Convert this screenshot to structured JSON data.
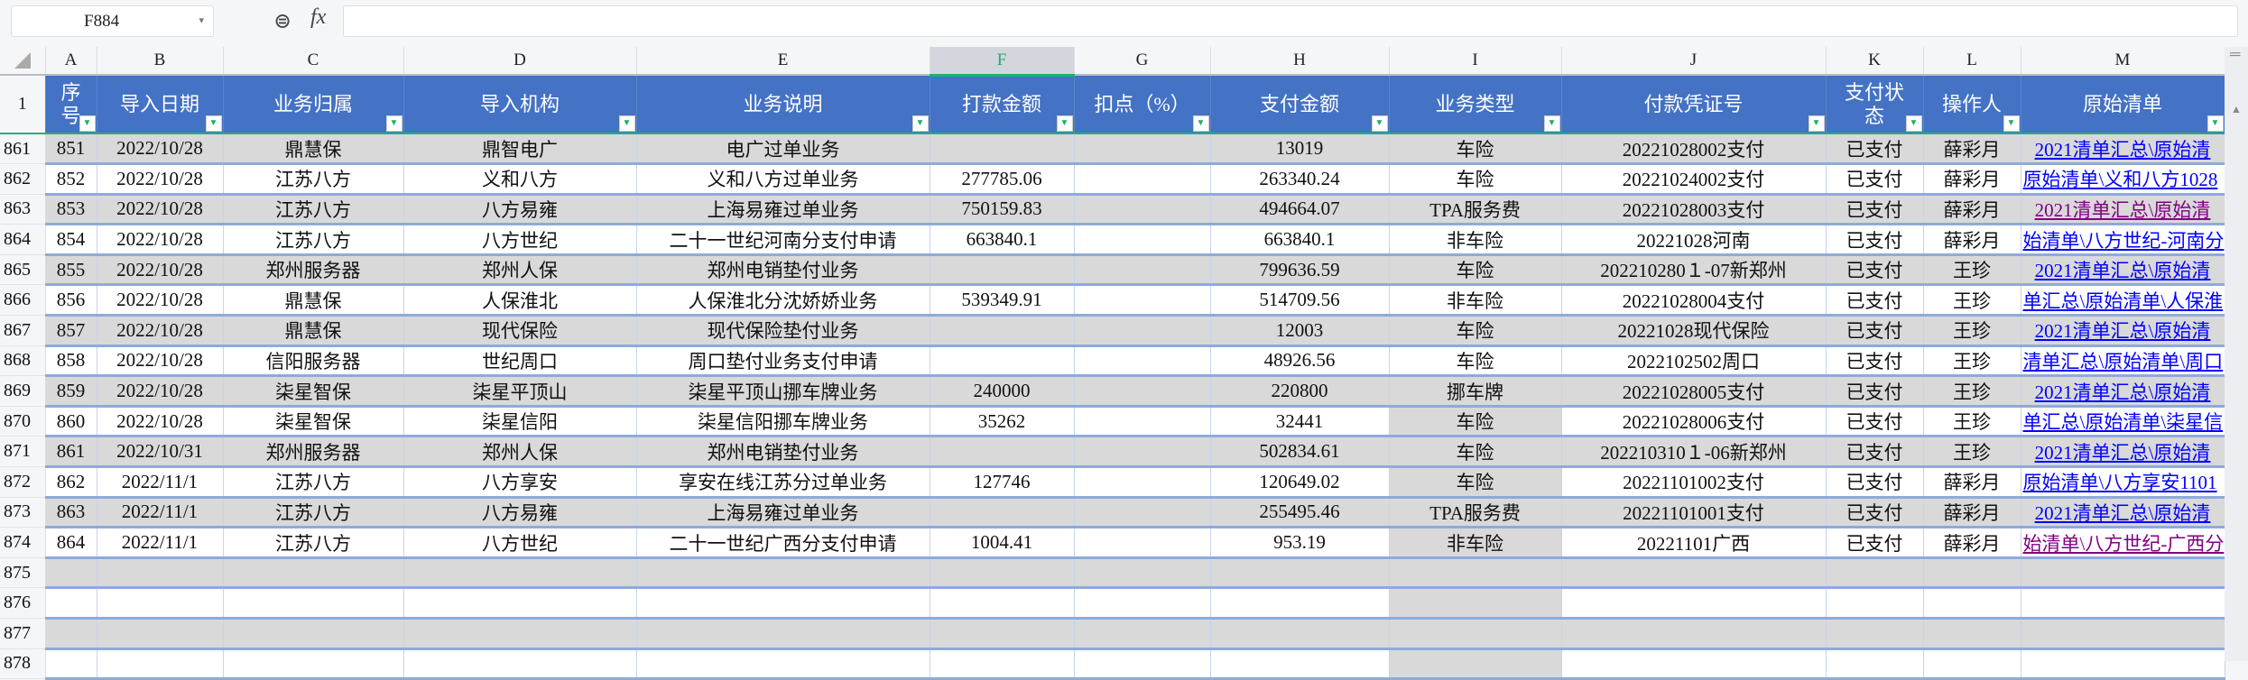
{
  "formula_bar": {
    "cell_ref": "F884",
    "fx_label": "fx",
    "formula": ""
  },
  "column_letters": [
    "A",
    "B",
    "C",
    "D",
    "E",
    "F",
    "G",
    "H",
    "I",
    "J",
    "K",
    "L",
    "M"
  ],
  "selected_column": "F",
  "header_row_number": "1",
  "headers": [
    "序号",
    "导入日期",
    "业务归属",
    "导入机构",
    "业务说明",
    "打款金额",
    "扣点（%）",
    "支付金额",
    "业务类型",
    "付款凭证号",
    "支付状态",
    "操作人",
    "原始清单"
  ],
  "rows": [
    {
      "n": "861",
      "cells": [
        "851",
        "2022/10/28",
        "鼎慧保",
        "鼎智电广",
        "电广过单业务",
        "",
        "",
        "13019",
        "车险",
        "20221028002支付",
        "已支付",
        "薛彩月",
        "2021清单汇总\\原始清"
      ],
      "visited": false
    },
    {
      "n": "862",
      "cells": [
        "852",
        "2022/10/28",
        "江苏八方",
        "义和八方",
        "义和八方过单业务",
        "277785.06",
        "",
        "263340.24",
        "车险",
        "20221024002支付",
        "已支付",
        "薛彩月",
        "原始清单\\义和八方1028"
      ],
      "visited": false
    },
    {
      "n": "863",
      "cells": [
        "853",
        "2022/10/28",
        "江苏八方",
        "八方易雍",
        "上海易雍过单业务",
        "750159.83",
        "",
        "494664.07",
        "TPA服务费",
        "20221028003支付",
        "已支付",
        "薛彩月",
        "2021清单汇总\\原始清"
      ],
      "visited": true
    },
    {
      "n": "864",
      "cells": [
        "854",
        "2022/10/28",
        "江苏八方",
        "八方世纪",
        "二十一世纪河南分支付申请",
        "663840.1",
        "",
        "663840.1",
        "非车险",
        "20221028河南",
        "已支付",
        "薛彩月",
        "始清单\\八方世纪-河南分"
      ],
      "visited": false
    },
    {
      "n": "865",
      "cells": [
        "855",
        "2022/10/28",
        "郑州服务器",
        "郑州人保",
        "郑州电销垫付业务",
        "",
        "",
        "799636.59",
        "车险",
        "202210280１-07新郑州",
        "已支付",
        "王珍",
        "2021清单汇总\\原始清"
      ],
      "visited": false
    },
    {
      "n": "866",
      "cells": [
        "856",
        "2022/10/28",
        "鼎慧保",
        "人保淮北",
        "人保淮北分沈娇娇业务",
        "539349.91",
        "",
        "514709.56",
        "非车险",
        "20221028004支付",
        "已支付",
        "王珍",
        "单汇总\\原始清单\\人保淮"
      ],
      "visited": false
    },
    {
      "n": "867",
      "cells": [
        "857",
        "2022/10/28",
        "鼎慧保",
        "现代保险",
        "现代保险垫付业务",
        "",
        "",
        "12003",
        "车险",
        "20221028现代保险",
        "已支付",
        "王珍",
        "2021清单汇总\\原始清"
      ],
      "visited": false
    },
    {
      "n": "868",
      "cells": [
        "858",
        "2022/10/28",
        "信阳服务器",
        "世纪周口",
        "周口垫付业务支付申请",
        "",
        "",
        "48926.56",
        "车险",
        "2022102502周口",
        "已支付",
        "王珍",
        "清单汇总\\原始清单\\周口"
      ],
      "visited": false
    },
    {
      "n": "869",
      "cells": [
        "859",
        "2022/10/28",
        "柒星智保",
        "柒星平顶山",
        "柒星平顶山挪车牌业务",
        "240000",
        "",
        "220800",
        "挪车牌",
        "20221028005支付",
        "已支付",
        "王珍",
        "2021清单汇总\\原始清"
      ],
      "visited": false
    },
    {
      "n": "870",
      "cells": [
        "860",
        "2022/10/28",
        "柒星智保",
        "柒星信阳",
        "柒星信阳挪车牌业务",
        "35262",
        "",
        "32441",
        "车险",
        "20221028006支付",
        "已支付",
        "王珍",
        "单汇总\\原始清单\\柒星信"
      ],
      "visited": false
    },
    {
      "n": "871",
      "cells": [
        "861",
        "2022/10/31",
        "郑州服务器",
        "郑州人保",
        "郑州电销垫付业务",
        "",
        "",
        "502834.61",
        "车险",
        "202210310１-06新郑州",
        "已支付",
        "王珍",
        "2021清单汇总\\原始清"
      ],
      "visited": false
    },
    {
      "n": "872",
      "cells": [
        "862",
        "2022/11/1",
        "江苏八方",
        "八方享安",
        "享安在线江苏分过单业务",
        "127746",
        "",
        "120649.02",
        "车险",
        "20221101002支付",
        "已支付",
        "薛彩月",
        "原始清单\\八方享安1101"
      ],
      "visited": false
    },
    {
      "n": "873",
      "cells": [
        "863",
        "2022/11/1",
        "江苏八方",
        "八方易雍",
        "上海易雍过单业务",
        "",
        "",
        "255495.46",
        "TPA服务费",
        "20221101001支付",
        "已支付",
        "薛彩月",
        "2021清单汇总\\原始清"
      ],
      "visited": false
    },
    {
      "n": "874",
      "cells": [
        "864",
        "2022/11/1",
        "江苏八方",
        "八方世纪",
        "二十一世纪广西分支付申请",
        "1004.41",
        "",
        "953.19",
        "非车险",
        "20221101广西",
        "已支付",
        "薛彩月",
        "始清单\\八方世纪-广西分"
      ],
      "visited": true
    },
    {
      "n": "875",
      "cells": [
        "",
        "",
        "",
        "",
        "",
        "",
        "",
        "",
        "",
        "",
        "",
        "",
        ""
      ],
      "visited": false
    },
    {
      "n": "876",
      "cells": [
        "",
        "",
        "",
        "",
        "",
        "",
        "",
        "",
        "",
        "",
        "",
        "",
        ""
      ],
      "visited": false
    },
    {
      "n": "877",
      "cells": [
        "",
        "",
        "",
        "",
        "",
        "",
        "",
        "",
        "",
        "",
        "",
        "",
        ""
      ],
      "visited": false
    },
    {
      "n": "878",
      "cells": [
        "",
        "",
        "",
        "",
        "",
        "",
        "",
        "",
        "",
        "",
        "",
        "",
        ""
      ],
      "visited": false
    }
  ],
  "colors": {
    "header_bg": "#4472c4",
    "stripe": "#d9d9d9",
    "row_border": "#8eaadb",
    "link": "#0000ff",
    "visited_link": "#800080",
    "accent": "#1fae6a"
  }
}
